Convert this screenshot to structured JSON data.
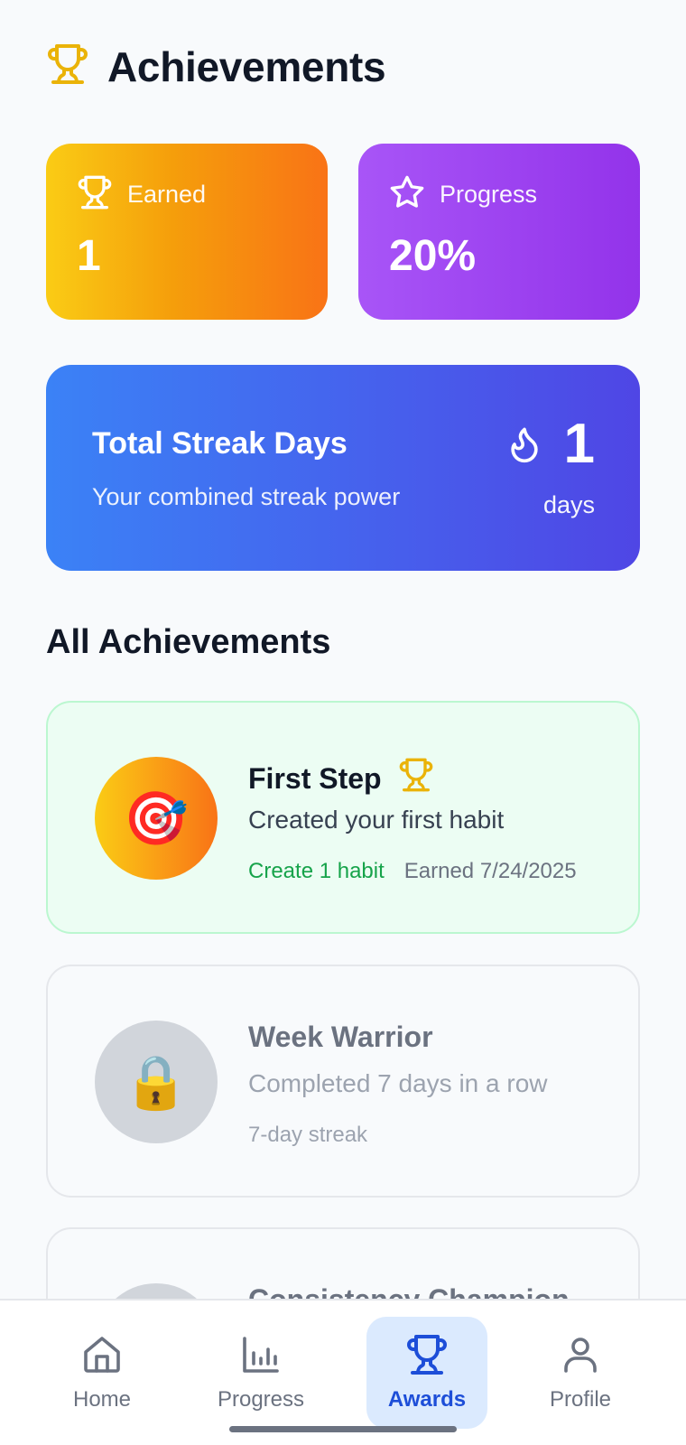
{
  "header": {
    "title": "Achievements",
    "icon": "trophy-icon",
    "icon_color": "#eab308"
  },
  "stats": {
    "earned": {
      "label": "Earned",
      "value": "1",
      "icon": "trophy-icon"
    },
    "progress": {
      "label": "Progress",
      "value": "20%",
      "icon": "star-icon"
    }
  },
  "streak": {
    "title": "Total Streak Days",
    "subtitle": "Your combined streak power",
    "value": "1",
    "unit": "days",
    "icon": "flame-icon"
  },
  "section": {
    "title": "All Achievements"
  },
  "achievements": [
    {
      "title": "First Step",
      "description": "Created your first habit",
      "requirement": "Create 1 habit",
      "earned_text": "Earned 7/24/2025",
      "badge": "🎯",
      "state": "earned"
    },
    {
      "title": "Week Warrior",
      "description": "Completed 7 days in a row",
      "requirement": "7-day streak",
      "badge": "🔒",
      "state": "locked"
    },
    {
      "title": "Consistency Champion",
      "state": "locked"
    }
  ],
  "nav": {
    "items": [
      {
        "label": "Home",
        "icon": "home-icon"
      },
      {
        "label": "Progress",
        "icon": "bar-chart-icon"
      },
      {
        "label": "Awards",
        "icon": "trophy-icon",
        "active": true
      },
      {
        "label": "Profile",
        "icon": "user-icon"
      }
    ]
  },
  "colors": {
    "earned_gradient": [
      "#facc15",
      "#f97316"
    ],
    "progress_gradient": [
      "#a855f7",
      "#9333ea"
    ],
    "streak_gradient": [
      "#3b82f6",
      "#4f46e5"
    ],
    "active_nav": "#1d4ed8",
    "success": "#16a34a"
  }
}
